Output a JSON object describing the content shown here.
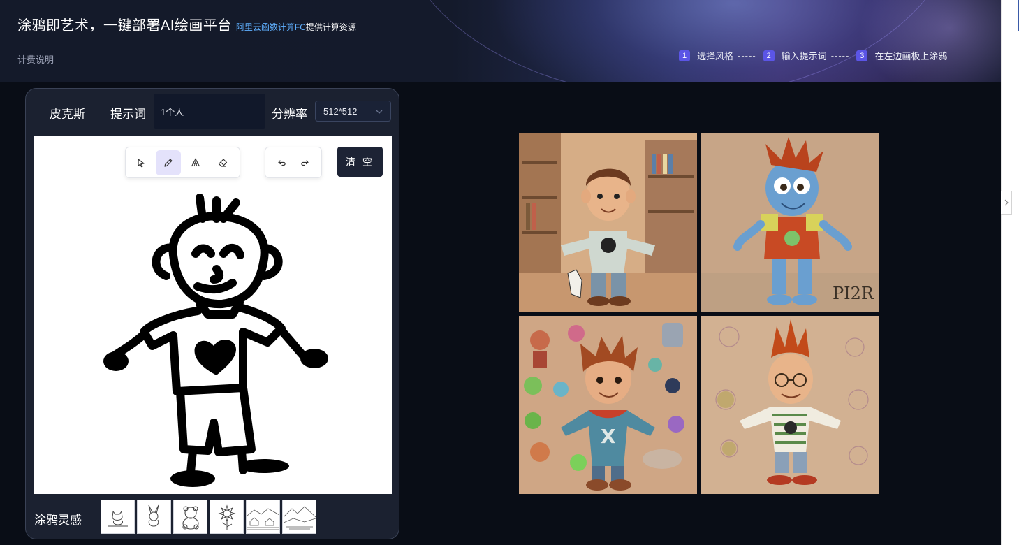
{
  "header": {
    "title": "涂鸦即艺术，一键部署AI绘画平台",
    "provider_link": "阿里云函数计算FC",
    "provider_suffix": "提供计算资源",
    "billing_link": "计费说明",
    "steps": [
      {
        "num": "1",
        "label": "选择风格"
      },
      {
        "num": "2",
        "label": "输入提示词"
      },
      {
        "num": "3",
        "label": "在左边画板上涂鸦"
      }
    ],
    "step_separator": "-----"
  },
  "panel": {
    "style_name": "皮克斯",
    "prompt_label": "提示词",
    "prompt_value": "1个人",
    "resolution_label": "分辨率",
    "resolution_value": "512*512",
    "clear_label": "清 空",
    "tools": [
      {
        "name": "select-tool",
        "icon": "cursor-arrow-icon"
      },
      {
        "name": "pencil-tool",
        "icon": "pencil-icon",
        "active": true
      },
      {
        "name": "text-tool",
        "icon": "text-icon"
      },
      {
        "name": "eraser-tool",
        "icon": "eraser-icon"
      }
    ],
    "inspiration_label": "涂鸦灵感",
    "inspirations": [
      "cat",
      "rabbit",
      "bear",
      "sunflower",
      "village",
      "mountains"
    ]
  },
  "colors": {
    "accent": "#5b55e6",
    "link": "#5fb0ff",
    "background": "#090d16",
    "panel": "#1b2130"
  },
  "results": [
    {
      "name": "boy-in-library"
    },
    {
      "name": "blue-creature"
    },
    {
      "name": "boy-with-monsters"
    },
    {
      "name": "boy-with-glasses"
    }
  ]
}
